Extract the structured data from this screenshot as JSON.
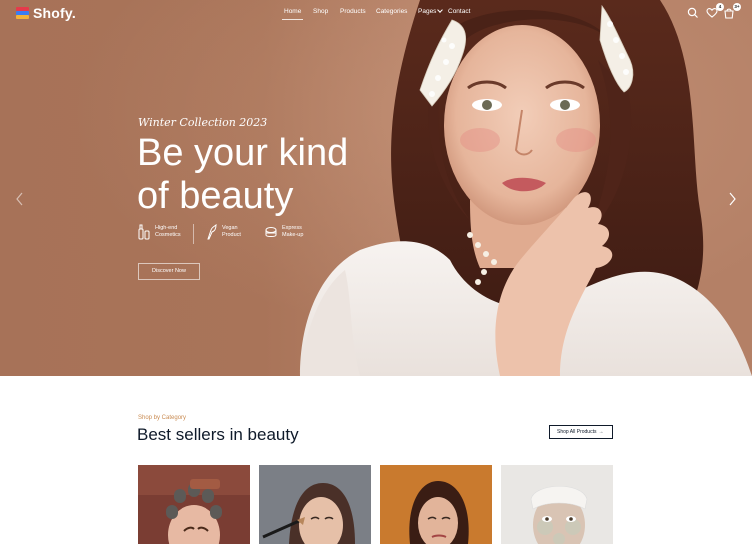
{
  "brand": {
    "name": "Shofy."
  },
  "nav": [
    {
      "label": "Home",
      "active": true
    },
    {
      "label": "Shop"
    },
    {
      "label": "Products"
    },
    {
      "label": "Categories"
    },
    {
      "label": "Pages",
      "has_dropdown": true
    },
    {
      "label": "Contact"
    }
  ],
  "header_icons": [
    {
      "name": "search-icon"
    },
    {
      "name": "heart-icon",
      "badge": "4"
    },
    {
      "name": "cart-icon",
      "badge": "3+"
    }
  ],
  "hero": {
    "subtitle": "Winter Collection 2023",
    "title_line1": "Be your kind",
    "title_line2": "of beauty",
    "features": [
      {
        "icon": "cosmetics-icon",
        "line1": "High-end",
        "line2": "Cosmetics"
      },
      {
        "icon": "vegan-product-icon",
        "line1": "Vegan",
        "line2": "Product"
      },
      {
        "icon": "makeup-icon",
        "line1": "Express",
        "line2": "Make-up"
      }
    ],
    "cta": "Discover Now"
  },
  "section": {
    "eyebrow": "Shop by Category",
    "title": "Best sellers in beauty",
    "shop_all": "Shop All Products",
    "cards": [
      {
        "name": "hair-curlers-photo"
      },
      {
        "name": "makeup-brush-photo"
      },
      {
        "name": "orange-background-portrait-photo"
      },
      {
        "name": "face-mask-photo"
      }
    ]
  },
  "colors": {
    "hero_bg": "#a97459",
    "accent": "#c98b52",
    "heading": "#0f1a2a"
  }
}
